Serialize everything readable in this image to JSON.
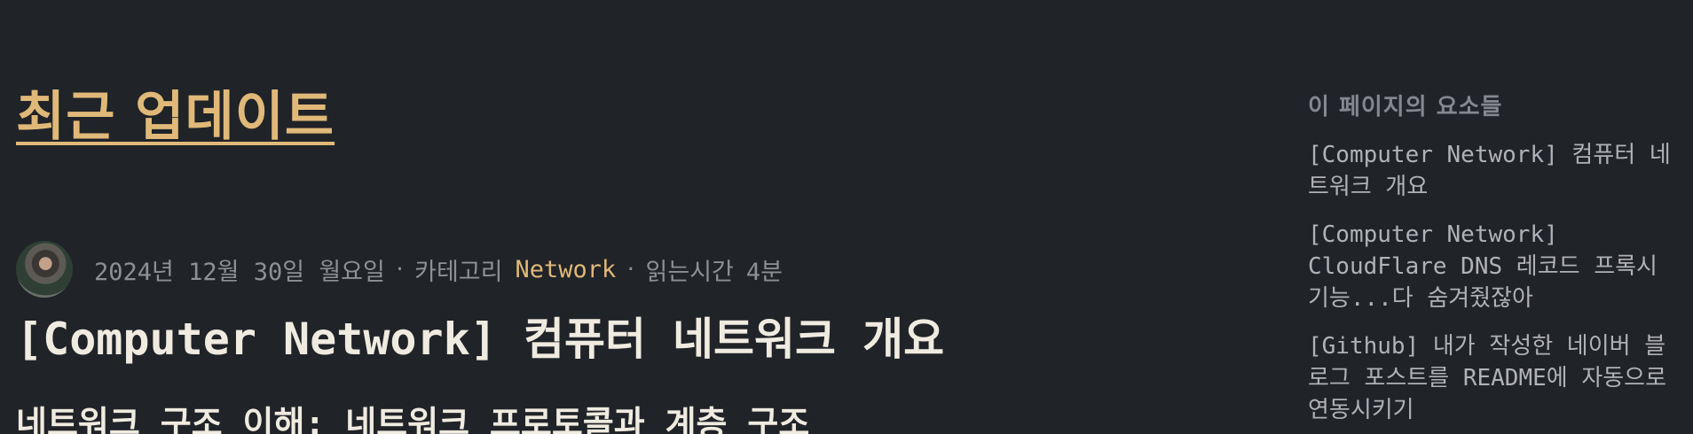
{
  "main": {
    "section_title": "최근 업데이트",
    "post": {
      "date": "2024년 12월 30일 월요일",
      "separator": "·",
      "category_label": "카테고리",
      "category": "Network",
      "read_time_label": "읽는시간",
      "read_time": "4분",
      "title": "[Computer Network] 컴퓨터 네트워크 개요",
      "excerpt": "네트워크 구조 이해: 네트워크 프로토콜과 계층 구조"
    }
  },
  "toc": {
    "heading": "이 페이지의 요소들",
    "items": [
      "[Computer Network] 컴퓨터 네트워크 개요",
      "[Computer Network] CloudFlare DNS 레코드 프록시 기능...다 숨겨줬잖아",
      "[Github] 내가 작성한 네이버 블로그 포스트를 README에 자동으로 연동시키기"
    ]
  },
  "colors": {
    "background": "#202328",
    "accent": "#e0b979",
    "title_text": "#f0ebe0",
    "meta_text": "#8d9095",
    "toc_text": "#b0b2b6"
  }
}
